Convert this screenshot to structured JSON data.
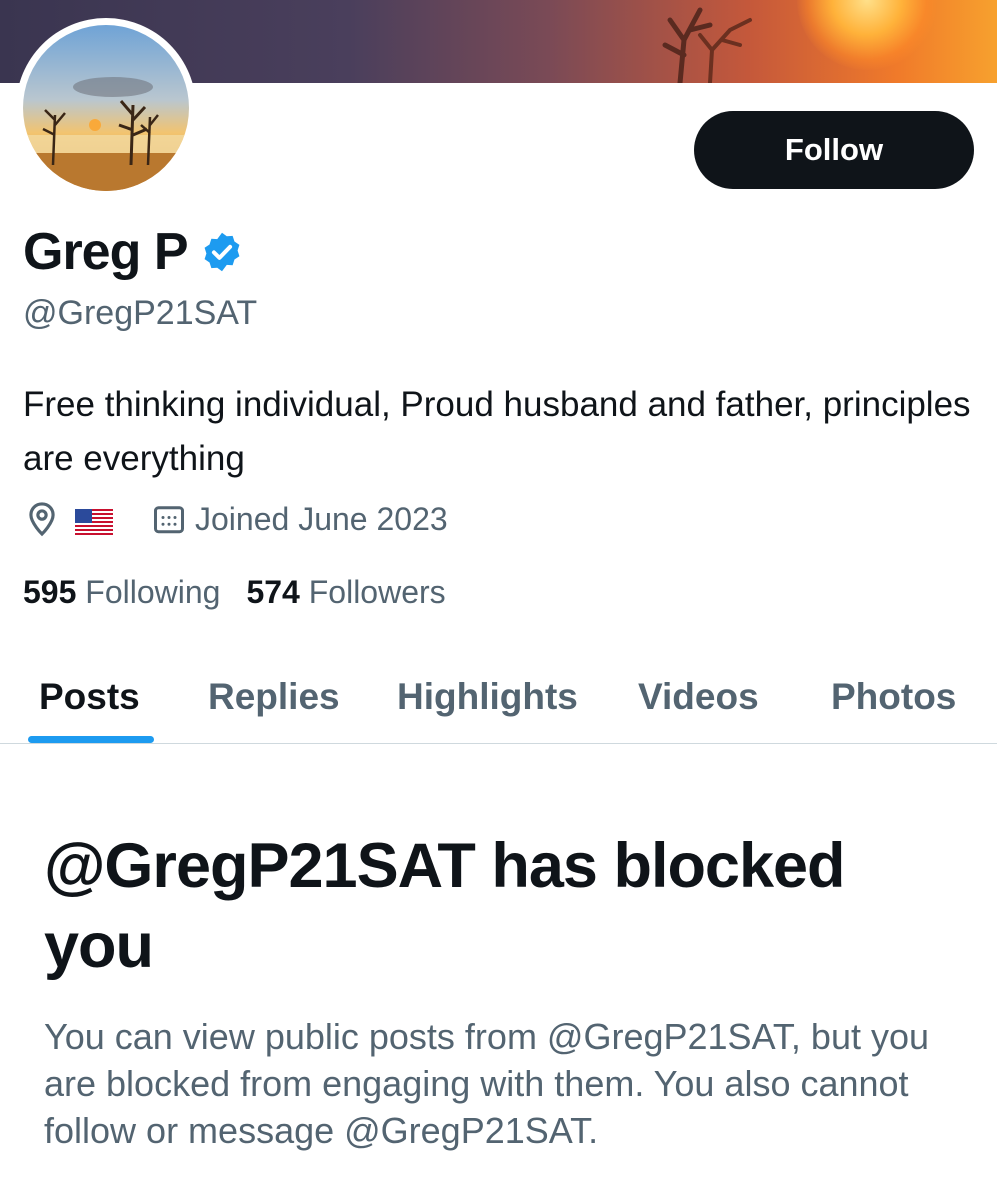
{
  "colors": {
    "text_primary": "#0f1419",
    "text_secondary": "#536471",
    "accent": "#1d9bf0",
    "button_bg": "#0f1419"
  },
  "profile": {
    "name": "Greg P",
    "verified_icon": "verified-badge-icon",
    "handle": "@GregP21SAT",
    "bio": "Free thinking individual, Proud husband and father, principles are everything",
    "location_icon": "location-pin-icon",
    "location_flag": "🇺🇸",
    "calendar_icon": "calendar-icon",
    "joined": "Joined June 2023",
    "following_count": "595",
    "following_label": "Following",
    "followers_count": "574",
    "followers_label": "Followers"
  },
  "actions": {
    "follow_label": "Follow"
  },
  "tabs": [
    {
      "label": "Posts",
      "active": true
    },
    {
      "label": "Replies",
      "active": false
    },
    {
      "label": "Highlights",
      "active": false
    },
    {
      "label": "Videos",
      "active": false
    },
    {
      "label": "Photos",
      "active": false
    }
  ],
  "blocked": {
    "title": "@GregP21SAT has blocked you",
    "description": "You can view public posts from @GregP21SAT, but you are blocked from engaging with them. You also cannot follow or message @GregP21SAT."
  }
}
